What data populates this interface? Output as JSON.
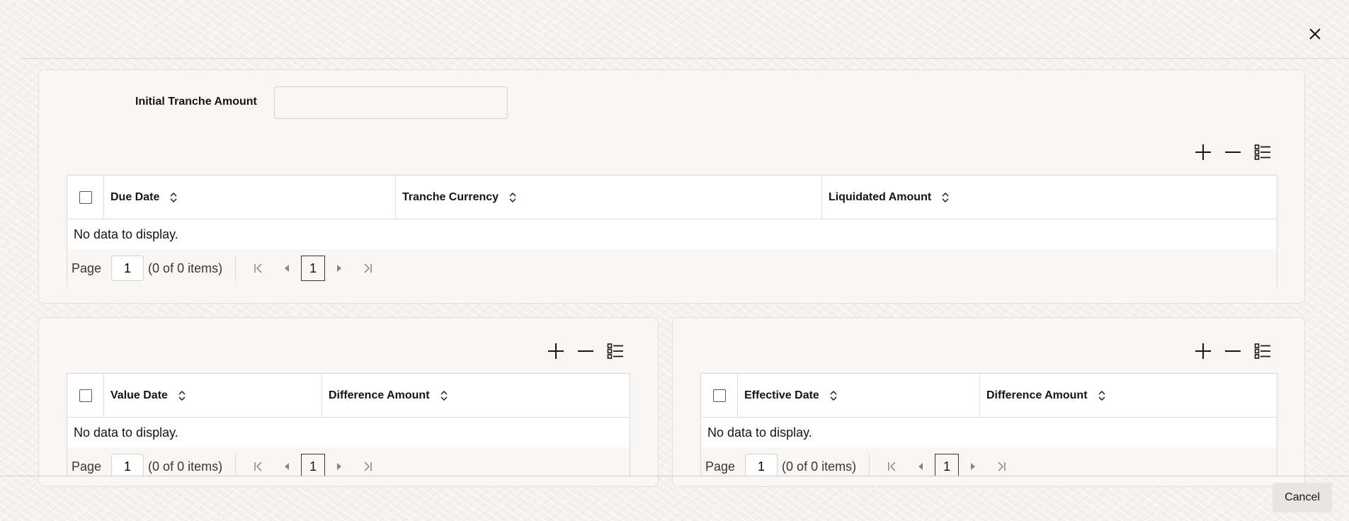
{
  "dialog": {
    "close_icon": "close-icon"
  },
  "tranche": {
    "initial_amount_label": "Initial Tranche Amount",
    "initial_amount_value": "",
    "toolbar": {
      "add_icon": "plus-icon",
      "remove_icon": "minus-icon",
      "columns_icon": "list-columns-icon"
    },
    "columns": [
      "Due Date",
      "Tranche Currency",
      "Liquidated Amount"
    ],
    "no_data": "No data to display.",
    "pager": {
      "page_label": "Page",
      "page_value": "1",
      "items_text": "(0 of 0 items)",
      "current_page": "1"
    }
  },
  "value_grid": {
    "columns": [
      "Value Date",
      "Difference Amount"
    ],
    "no_data": "No data to display.",
    "pager": {
      "page_label": "Page",
      "page_value": "1",
      "items_text": "(0 of 0 items)",
      "current_page": "1"
    }
  },
  "effective_grid": {
    "columns": [
      "Effective Date",
      "Difference Amount"
    ],
    "no_data": "No data to display.",
    "pager": {
      "page_label": "Page",
      "page_value": "1",
      "items_text": "(0 of 0 items)",
      "current_page": "1"
    }
  },
  "footer": {
    "cancel_label": "Cancel"
  }
}
